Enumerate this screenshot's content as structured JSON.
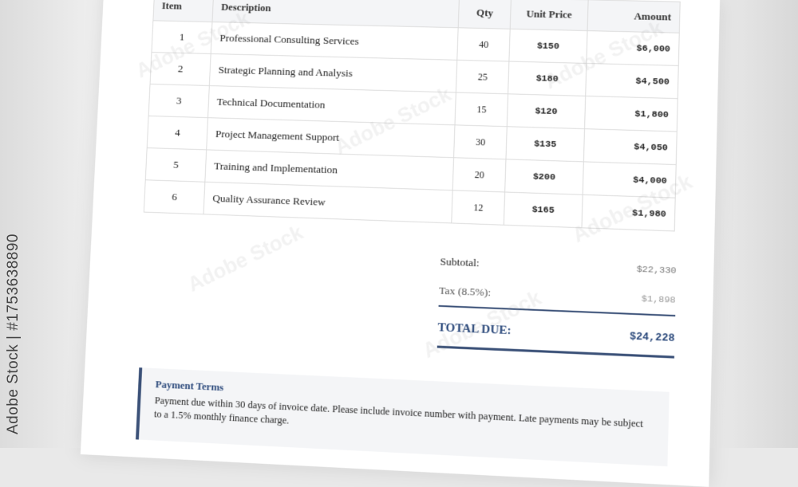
{
  "stock_credit": "Adobe Stock | #1753638890",
  "watermark_text": "Adobe Stock",
  "table": {
    "headers": [
      "Item",
      "Description",
      "Qty",
      "Unit Price",
      "Amount"
    ],
    "rows": [
      {
        "item": "1",
        "description": "Professional Consulting Services",
        "qty": "40",
        "unit_price": "$150",
        "amount": "$6,000"
      },
      {
        "item": "2",
        "description": "Strategic Planning and Analysis",
        "qty": "25",
        "unit_price": "$180",
        "amount": "$4,500"
      },
      {
        "item": "3",
        "description": "Technical Documentation",
        "qty": "15",
        "unit_price": "$120",
        "amount": "$1,800"
      },
      {
        "item": "4",
        "description": "Project Management Support",
        "qty": "30",
        "unit_price": "$135",
        "amount": "$4,050"
      },
      {
        "item": "5",
        "description": "Training and Implementation",
        "qty": "20",
        "unit_price": "$200",
        "amount": "$4,000"
      },
      {
        "item": "6",
        "description": "Quality Assurance Review",
        "qty": "12",
        "unit_price": "$165",
        "amount": "$1,980"
      }
    ]
  },
  "totals": {
    "subtotal_label": "Subtotal:",
    "subtotal_value": "$22,330",
    "tax_label": "Tax (8.5%):",
    "tax_value": "$1,898",
    "total_label": "TOTAL DUE:",
    "total_value": "$24,228"
  },
  "terms": {
    "title": "Payment Terms",
    "text": "Payment due within 30 days of invoice date. Please include invoice number with payment. Late payments may be subject to a 1.5% monthly finance charge."
  },
  "colors": {
    "accent": "#2c4a7c",
    "rule": "#3b5178",
    "header_bg": "#f4f5f7"
  }
}
